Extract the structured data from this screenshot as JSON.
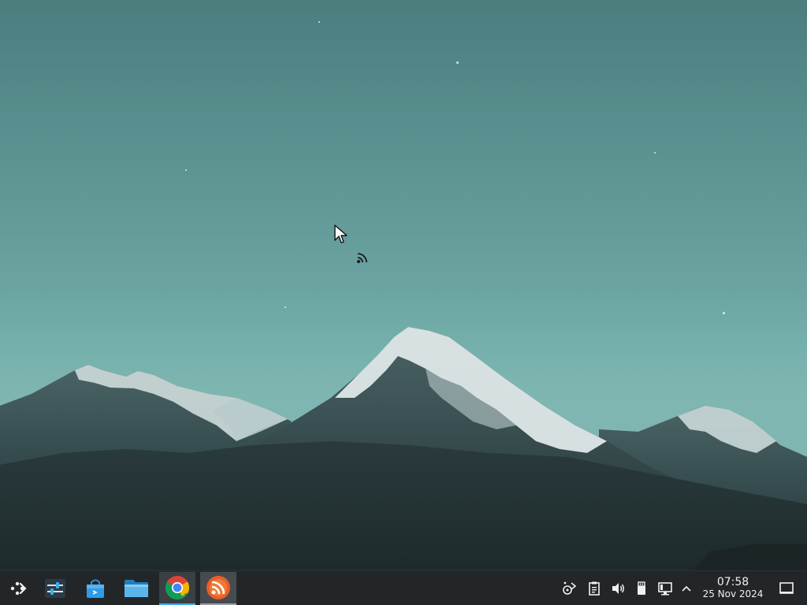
{
  "taskbar": {
    "launchers": [
      {
        "name": "application-launcher",
        "icon": "kde-launcher-icon"
      },
      {
        "name": "system-settings",
        "icon": "settings-sliders-icon"
      },
      {
        "name": "discover",
        "icon": "store-bag-icon"
      },
      {
        "name": "dolphin-file-manager",
        "icon": "folder-icon"
      },
      {
        "name": "google-chrome",
        "icon": "chrome-icon"
      },
      {
        "name": "rss-reader",
        "icon": "rss-icon"
      }
    ],
    "tray": [
      "network-share-icon",
      "clipboard-icon",
      "volume-icon",
      "usb-device-icon",
      "display-icon",
      "chevron-up-icon"
    ],
    "clock": {
      "time": "07:58",
      "date": "25 Nov 2024"
    }
  },
  "colors": {
    "taskbar_bg": "#232629",
    "accent": "#3daee9",
    "sky_top": "#4b7d7e",
    "sky_bottom": "#7fb6b1"
  }
}
